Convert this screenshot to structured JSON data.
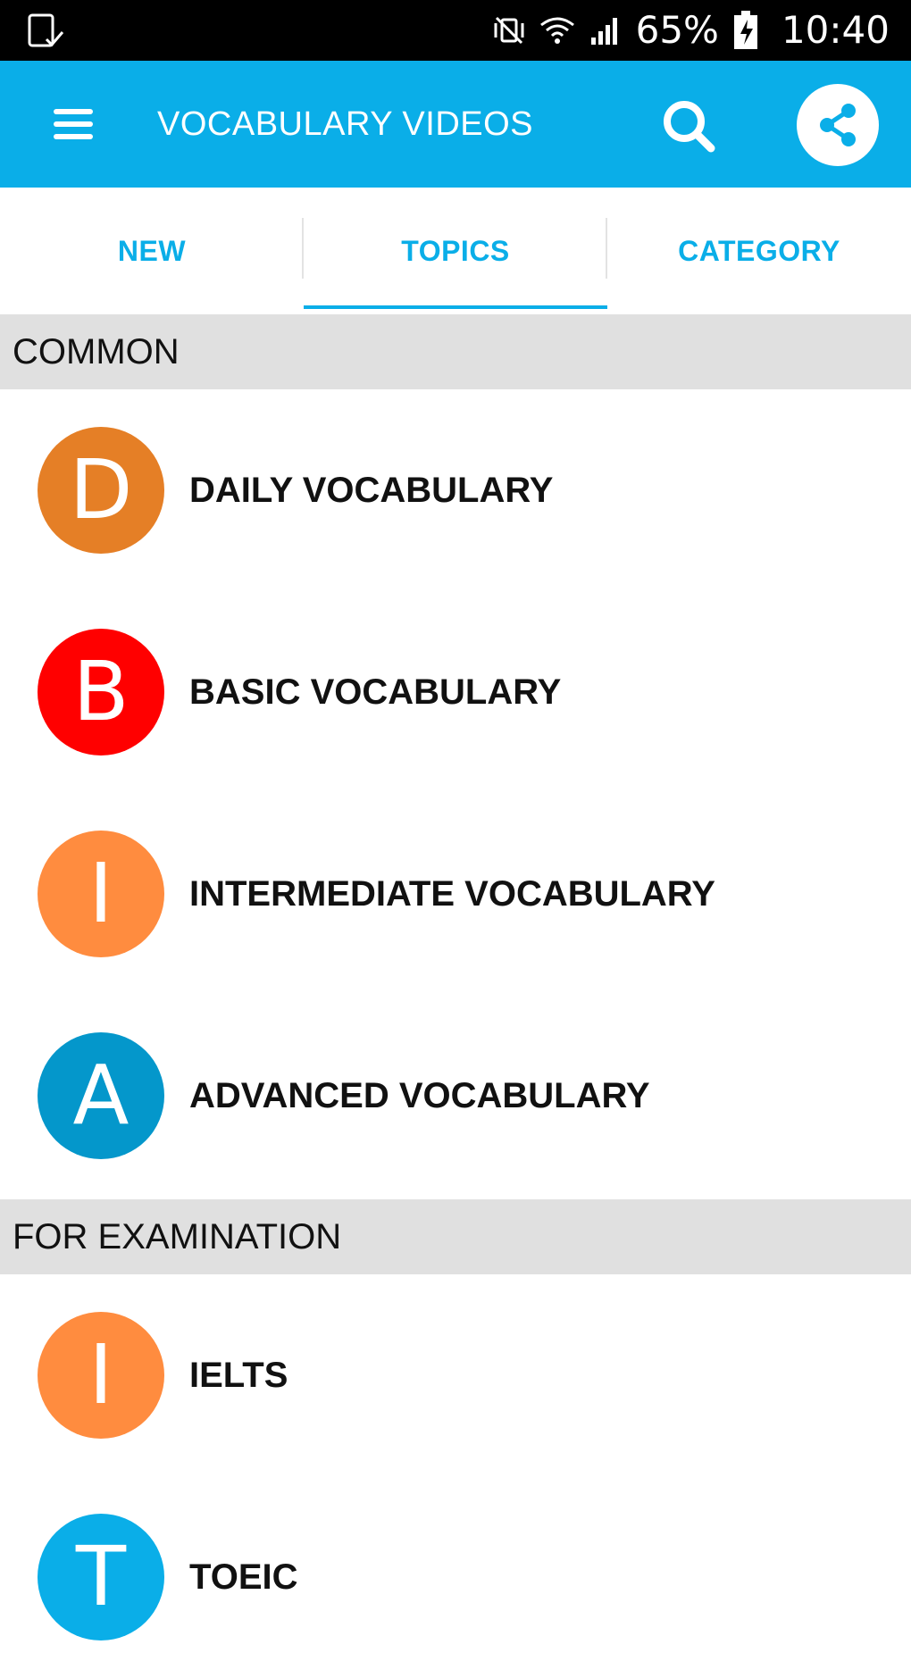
{
  "status_bar": {
    "battery": "65%",
    "time": "10:40",
    "icons": [
      "screenshot-icon",
      "vibrate-mute-icon",
      "wifi-icon",
      "signal-icon",
      "battery-charging-icon"
    ]
  },
  "app_bar": {
    "title": "VOCABULARY VIDEOS",
    "menu_icon": "hamburger-menu-icon",
    "search_icon": "search-icon",
    "share_icon": "share-icon",
    "color": "#0AAEE8"
  },
  "tabs": [
    {
      "label": "NEW",
      "selected": false
    },
    {
      "label": "TOPICS",
      "selected": true
    },
    {
      "label": "CATEGORY",
      "selected": false
    }
  ],
  "sections": [
    {
      "header": "COMMON",
      "items": [
        {
          "letter": "D",
          "label": "DAILY VOCABULARY",
          "color": "#E57F26"
        },
        {
          "letter": "B",
          "label": "BASIC VOCABULARY",
          "color": "#FF0000"
        },
        {
          "letter": "I",
          "label": "INTERMEDIATE VOCABULARY",
          "color": "#FF8C3F"
        },
        {
          "letter": "A",
          "label": "ADVANCED VOCABULARY",
          "color": "#0497CB"
        }
      ]
    },
    {
      "header": "FOR EXAMINATION",
      "items": [
        {
          "letter": "I",
          "label": "IELTS",
          "color": "#FF8C3F"
        },
        {
          "letter": "T",
          "label": "TOEIC",
          "color": "#0AAEE8"
        }
      ]
    }
  ]
}
